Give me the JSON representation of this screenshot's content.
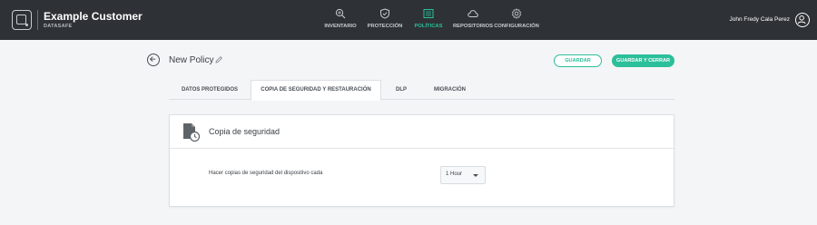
{
  "brand": {
    "name": "Example Customer",
    "product": "DATASAFE"
  },
  "nav": {
    "items": [
      {
        "label": "INVENTARIO",
        "icon": "search-icon"
      },
      {
        "label": "PROTECCIÓN",
        "icon": "shield-icon"
      },
      {
        "label": "POLÍTICAS",
        "icon": "policy-list-icon",
        "active": true
      },
      {
        "label": "REPOSITORIOS",
        "icon": "cloud-icon"
      },
      {
        "label": "CONFIGURACIÓN",
        "icon": "gear-icon"
      }
    ]
  },
  "user": {
    "name": "John Fredy Cala Perez"
  },
  "page": {
    "title": "New Policy"
  },
  "actions": {
    "save": "GUARDAR",
    "save_close": "GUARDAR Y CERRAR"
  },
  "tabs": [
    {
      "label": "DATOS PROTEGIDOS"
    },
    {
      "label": "COPIA DE SEGURIDAD Y RESTAURACIÓN",
      "active": true
    },
    {
      "label": "DLP"
    },
    {
      "label": "MIGRACIÓN"
    }
  ],
  "card": {
    "title": "Copia de seguridad",
    "row_label": "Hacer copias de seguridad del dispositivo cada",
    "interval_value": "1 Hour"
  },
  "colors": {
    "accent": "#2bbf9a",
    "topbar": "#2e3236",
    "background": "#f4f5f6"
  }
}
